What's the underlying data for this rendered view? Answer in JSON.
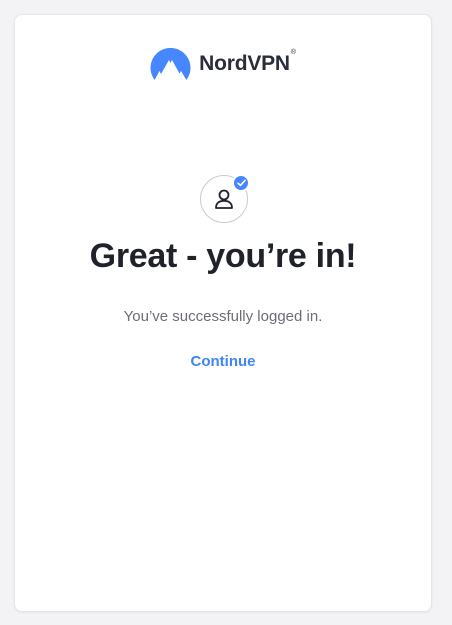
{
  "brand": {
    "name": "NordVPN",
    "trademark": "®",
    "logo_icon": "nordvpn-mountain-logo",
    "logo_color": "#4687ff"
  },
  "status": {
    "avatar_icon": "user-icon",
    "badge_icon": "checkmark-icon",
    "badge_color": "#4687ff"
  },
  "main": {
    "heading": "Great - you’re in!",
    "message": "You’ve successfully logged in.",
    "continue_label": "Continue",
    "link_color": "#3e86f5"
  }
}
